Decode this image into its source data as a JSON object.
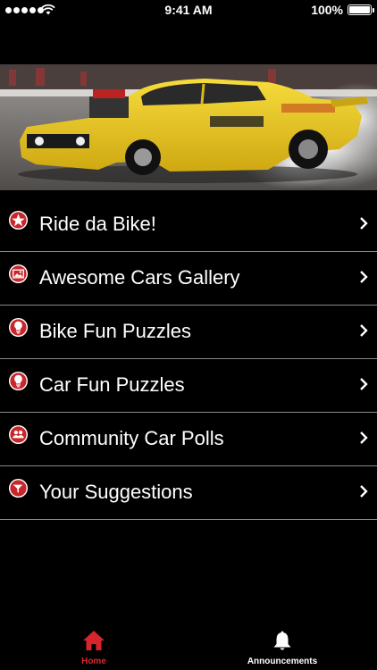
{
  "status_bar": {
    "time": "9:41 AM",
    "battery": "100%"
  },
  "hero": {
    "image": "yellow-drag-racing-car-burnout"
  },
  "menu": {
    "items": [
      {
        "label": "Ride da Bike!",
        "icon": "star-icon"
      },
      {
        "label": "Awesome Cars Gallery",
        "icon": "gallery-icon"
      },
      {
        "label": "Bike Fun Puzzles",
        "icon": "lightbulb-icon"
      },
      {
        "label": "Car Fun Puzzles",
        "icon": "lightbulb-icon"
      },
      {
        "label": "Community Car Polls",
        "icon": "group-icon"
      },
      {
        "label": "Your Suggestions",
        "icon": "megaphone-icon"
      }
    ]
  },
  "tab_bar": {
    "tabs": [
      {
        "label": "Home",
        "icon": "home-icon",
        "active": true
      },
      {
        "label": "Announcements",
        "icon": "bell-icon",
        "active": false
      }
    ]
  },
  "colors": {
    "accent": "#d7262b",
    "icon_fill": "#c8262b",
    "background": "#000000",
    "divider": "#8a8a8a"
  }
}
